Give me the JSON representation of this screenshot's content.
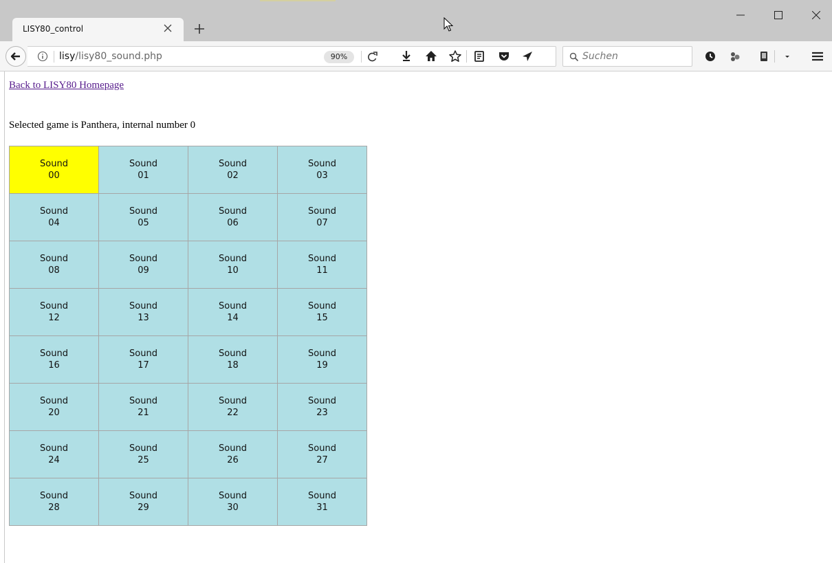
{
  "browser": {
    "tab_title": "LISY80_control",
    "url_host": "lisy",
    "url_path": "/lisy80_sound.php",
    "zoom": "90%",
    "search_placeholder": "Suchen"
  },
  "page": {
    "home_link": "Back to LISY80 Homepage",
    "selected_text": "Selected game is Panthera, internal number 0",
    "active_index": 0,
    "active_color": "#ffff00",
    "cell_color": "#b0dfe5",
    "sounds": [
      {
        "label": "Sound",
        "num": "00"
      },
      {
        "label": "Sound",
        "num": "01"
      },
      {
        "label": "Sound",
        "num": "02"
      },
      {
        "label": "Sound",
        "num": "03"
      },
      {
        "label": "Sound",
        "num": "04"
      },
      {
        "label": "Sound",
        "num": "05"
      },
      {
        "label": "Sound",
        "num": "06"
      },
      {
        "label": "Sound",
        "num": "07"
      },
      {
        "label": "Sound",
        "num": "08"
      },
      {
        "label": "Sound",
        "num": "09"
      },
      {
        "label": "Sound",
        "num": "10"
      },
      {
        "label": "Sound",
        "num": "11"
      },
      {
        "label": "Sound",
        "num": "12"
      },
      {
        "label": "Sound",
        "num": "13"
      },
      {
        "label": "Sound",
        "num": "14"
      },
      {
        "label": "Sound",
        "num": "15"
      },
      {
        "label": "Sound",
        "num": "16"
      },
      {
        "label": "Sound",
        "num": "17"
      },
      {
        "label": "Sound",
        "num": "18"
      },
      {
        "label": "Sound",
        "num": "19"
      },
      {
        "label": "Sound",
        "num": "20"
      },
      {
        "label": "Sound",
        "num": "21"
      },
      {
        "label": "Sound",
        "num": "22"
      },
      {
        "label": "Sound",
        "num": "23"
      },
      {
        "label": "Sound",
        "num": "24"
      },
      {
        "label": "Sound",
        "num": "25"
      },
      {
        "label": "Sound",
        "num": "26"
      },
      {
        "label": "Sound",
        "num": "27"
      },
      {
        "label": "Sound",
        "num": "28"
      },
      {
        "label": "Sound",
        "num": "29"
      },
      {
        "label": "Sound",
        "num": "30"
      },
      {
        "label": "Sound",
        "num": "31"
      }
    ]
  }
}
